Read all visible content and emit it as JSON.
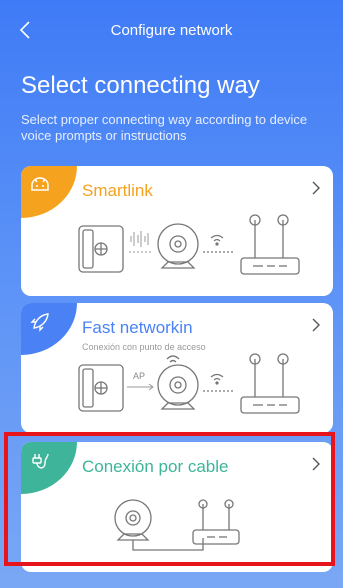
{
  "header": {
    "title": "Configure network"
  },
  "page": {
    "heading": "Select connecting way",
    "subtitle": "Select proper connecting way according to device voice prompts or instructions"
  },
  "options": [
    {
      "title": "Smartlink",
      "subtitle": "",
      "icon": "android-icon",
      "accent": "#f5a21f"
    },
    {
      "title": "Fast networkin",
      "subtitle": "Conexión con punto de acceso",
      "icon": "rocket-icon",
      "accent": "#4a82f5",
      "label": "AP"
    },
    {
      "title": "Conexión por cable",
      "subtitle": "",
      "icon": "ethernet-plug-icon",
      "accent": "#3eb59a"
    }
  ],
  "colors": {
    "background": "#4a86f6",
    "highlight": "#e8141c"
  }
}
